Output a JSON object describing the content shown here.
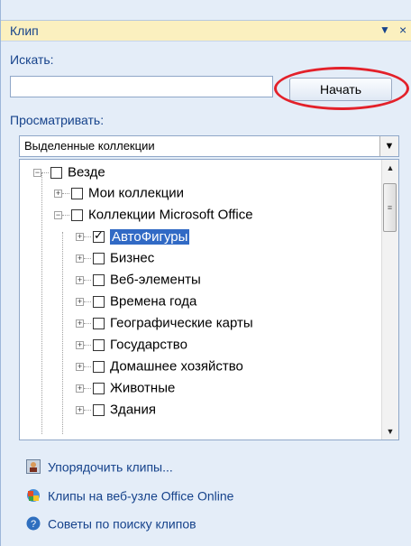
{
  "panel": {
    "title": "Клип",
    "search_label": "Искать:",
    "search_value": "",
    "start_button": "Начать",
    "browse_label": "Просматривать:",
    "browse_selected": "Выделенные коллекции"
  },
  "tree": [
    {
      "label": "Везде",
      "checked": false,
      "expander": "−"
    },
    {
      "label": "Мои коллекции",
      "checked": false,
      "expander": "+"
    },
    {
      "label": "Коллекции Microsoft Office",
      "checked": false,
      "expander": "−"
    },
    {
      "label": "АвтоФигуры",
      "checked": true,
      "selected": true,
      "expander": "+"
    },
    {
      "label": "Бизнес",
      "checked": false,
      "expander": "+"
    },
    {
      "label": "Веб-элементы",
      "checked": false,
      "expander": "+"
    },
    {
      "label": "Времена года",
      "checked": false,
      "expander": "+"
    },
    {
      "label": "Географические карты",
      "checked": false,
      "expander": "+"
    },
    {
      "label": "Государство",
      "checked": false,
      "expander": "+"
    },
    {
      "label": "Домашнее хозяйство",
      "checked": false,
      "expander": "+"
    },
    {
      "label": "Животные",
      "checked": false,
      "expander": "+"
    },
    {
      "label": "Здания",
      "checked": false,
      "expander": "+"
    }
  ],
  "links": {
    "organize": "Упорядочить клипы...",
    "online": "Клипы на веб-узле Office Online",
    "tips": "Советы по поиску клипов"
  },
  "colors": {
    "accent_text": "#15428b",
    "title_bg": "#fbf0bf",
    "highlight_circle": "#e3212a",
    "selection": "#316ac5"
  },
  "icons": {
    "organize": "organizer-person-icon",
    "online": "globe-office-icon",
    "tips": "help-question-icon"
  }
}
